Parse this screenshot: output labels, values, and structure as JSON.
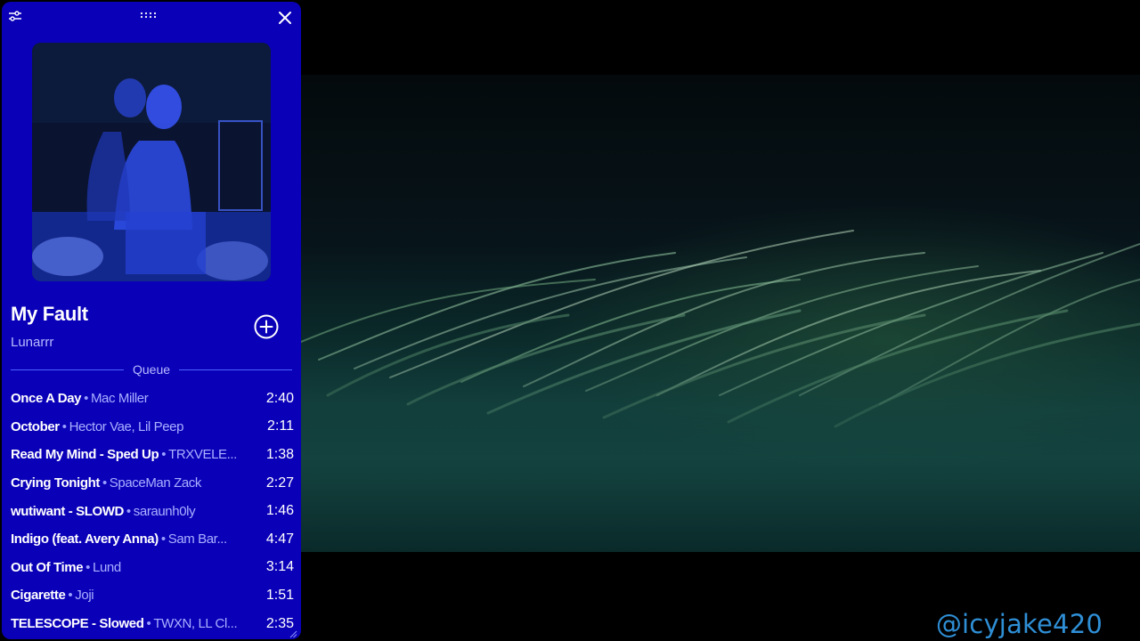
{
  "player": {
    "now_playing": {
      "title": "My Fault",
      "artist": "Lunarrr"
    },
    "icons": {
      "settings": "sliders-icon",
      "drag": "drag-handle-icon",
      "close": "close-icon",
      "add": "plus-circle-icon"
    },
    "queue_label": "Queue",
    "queue": [
      {
        "title": "Once A Day",
        "artist": "Mac Miller",
        "duration": "2:40"
      },
      {
        "title": "October",
        "artist": "Hector Vae, Lil Peep",
        "duration": "2:11"
      },
      {
        "title": "Read My Mind - Sped Up",
        "artist": "TRXVELE...",
        "duration": "1:38"
      },
      {
        "title": "Crying Tonight",
        "artist": "SpaceMan Zack",
        "duration": "2:27"
      },
      {
        "title": "wutiwant - SLOWD",
        "artist": "saraunh0ly",
        "duration": "1:46"
      },
      {
        "title": "Indigo (feat. Avery Anna)",
        "artist": "Sam Bar...",
        "duration": "4:47"
      },
      {
        "title": "Out Of Time",
        "artist": "Lund",
        "duration": "3:14"
      },
      {
        "title": "Cigarette",
        "artist": "Joji",
        "duration": "1:51"
      },
      {
        "title": "TELESCOPE - Slowed",
        "artist": "TWXN, LL Cl...",
        "duration": "2:35"
      }
    ],
    "colors": {
      "background": "#0a00b8",
      "secondary_text": "#b9bcff"
    }
  },
  "watermark": "@icyjake420"
}
